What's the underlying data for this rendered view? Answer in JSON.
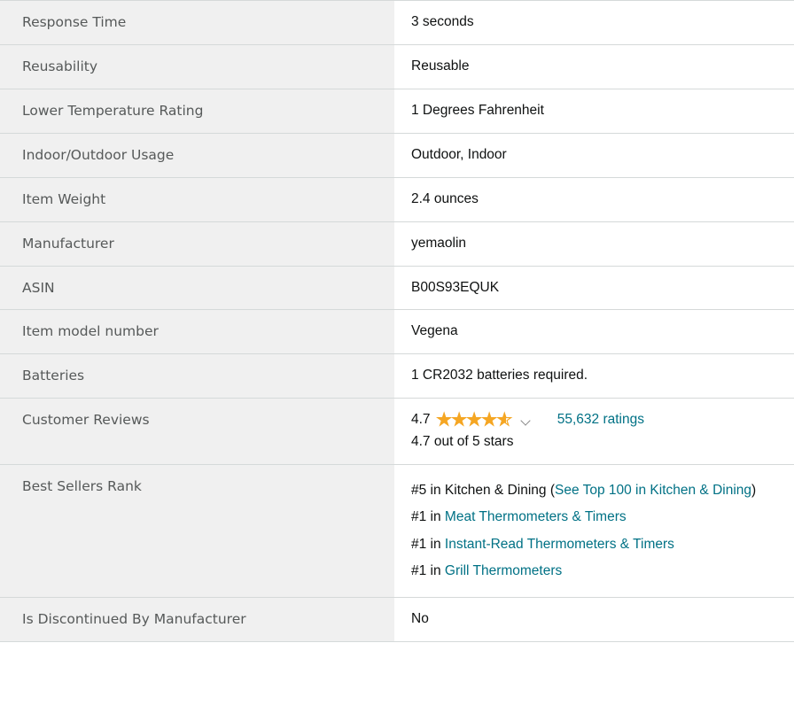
{
  "table": {
    "rows": [
      {
        "label": "Response Time",
        "value": "3 seconds"
      },
      {
        "label": "Reusability",
        "value": "Reusable"
      },
      {
        "label": "Lower Temperature Rating",
        "value": "1 Degrees Fahrenheit"
      },
      {
        "label": "Indoor/Outdoor Usage",
        "value": "Outdoor, Indoor"
      },
      {
        "label": "Item Weight",
        "value": "2.4 ounces"
      },
      {
        "label": "Manufacturer",
        "value": "yemaolin"
      },
      {
        "label": "ASIN",
        "value": "B00S93EQUK"
      },
      {
        "label": "Item model number",
        "value": "Vegena"
      },
      {
        "label": "Batteries",
        "value": "1 CR2032 batteries required."
      }
    ]
  },
  "customer_reviews": {
    "label": "Customer Reviews",
    "rating_value": "4.7",
    "rating_out_of": 5,
    "stars_glyphs": "★★★★★",
    "stars_fill_percent": 92,
    "dropdown_icon": "chevron-down-icon",
    "ratings_count_label": "55,632 ratings",
    "rating_text": "4.7 out of 5 stars"
  },
  "best_sellers_rank": {
    "label": "Best Sellers Rank",
    "entries": [
      {
        "prefix": "#5 in Kitchen & Dining (",
        "link": "See Top 100 in Kitchen & Dining",
        "suffix": ")"
      },
      {
        "prefix": "#1 in ",
        "link": "Meat Thermometers & Timers",
        "suffix": ""
      },
      {
        "prefix": "#1 in ",
        "link": "Instant-Read Thermometers & Timers",
        "suffix": ""
      },
      {
        "prefix": "#1 in ",
        "link": "Grill Thermometers",
        "suffix": ""
      }
    ]
  },
  "discontinued": {
    "label": "Is Discontinued By Manufacturer",
    "value": "No"
  },
  "colors": {
    "label_background": "#f0f0f0",
    "label_text": "#565959",
    "value_text": "#0f1111",
    "link": "#007185",
    "star": "#f5a623",
    "border": "#d5d9d9"
  }
}
